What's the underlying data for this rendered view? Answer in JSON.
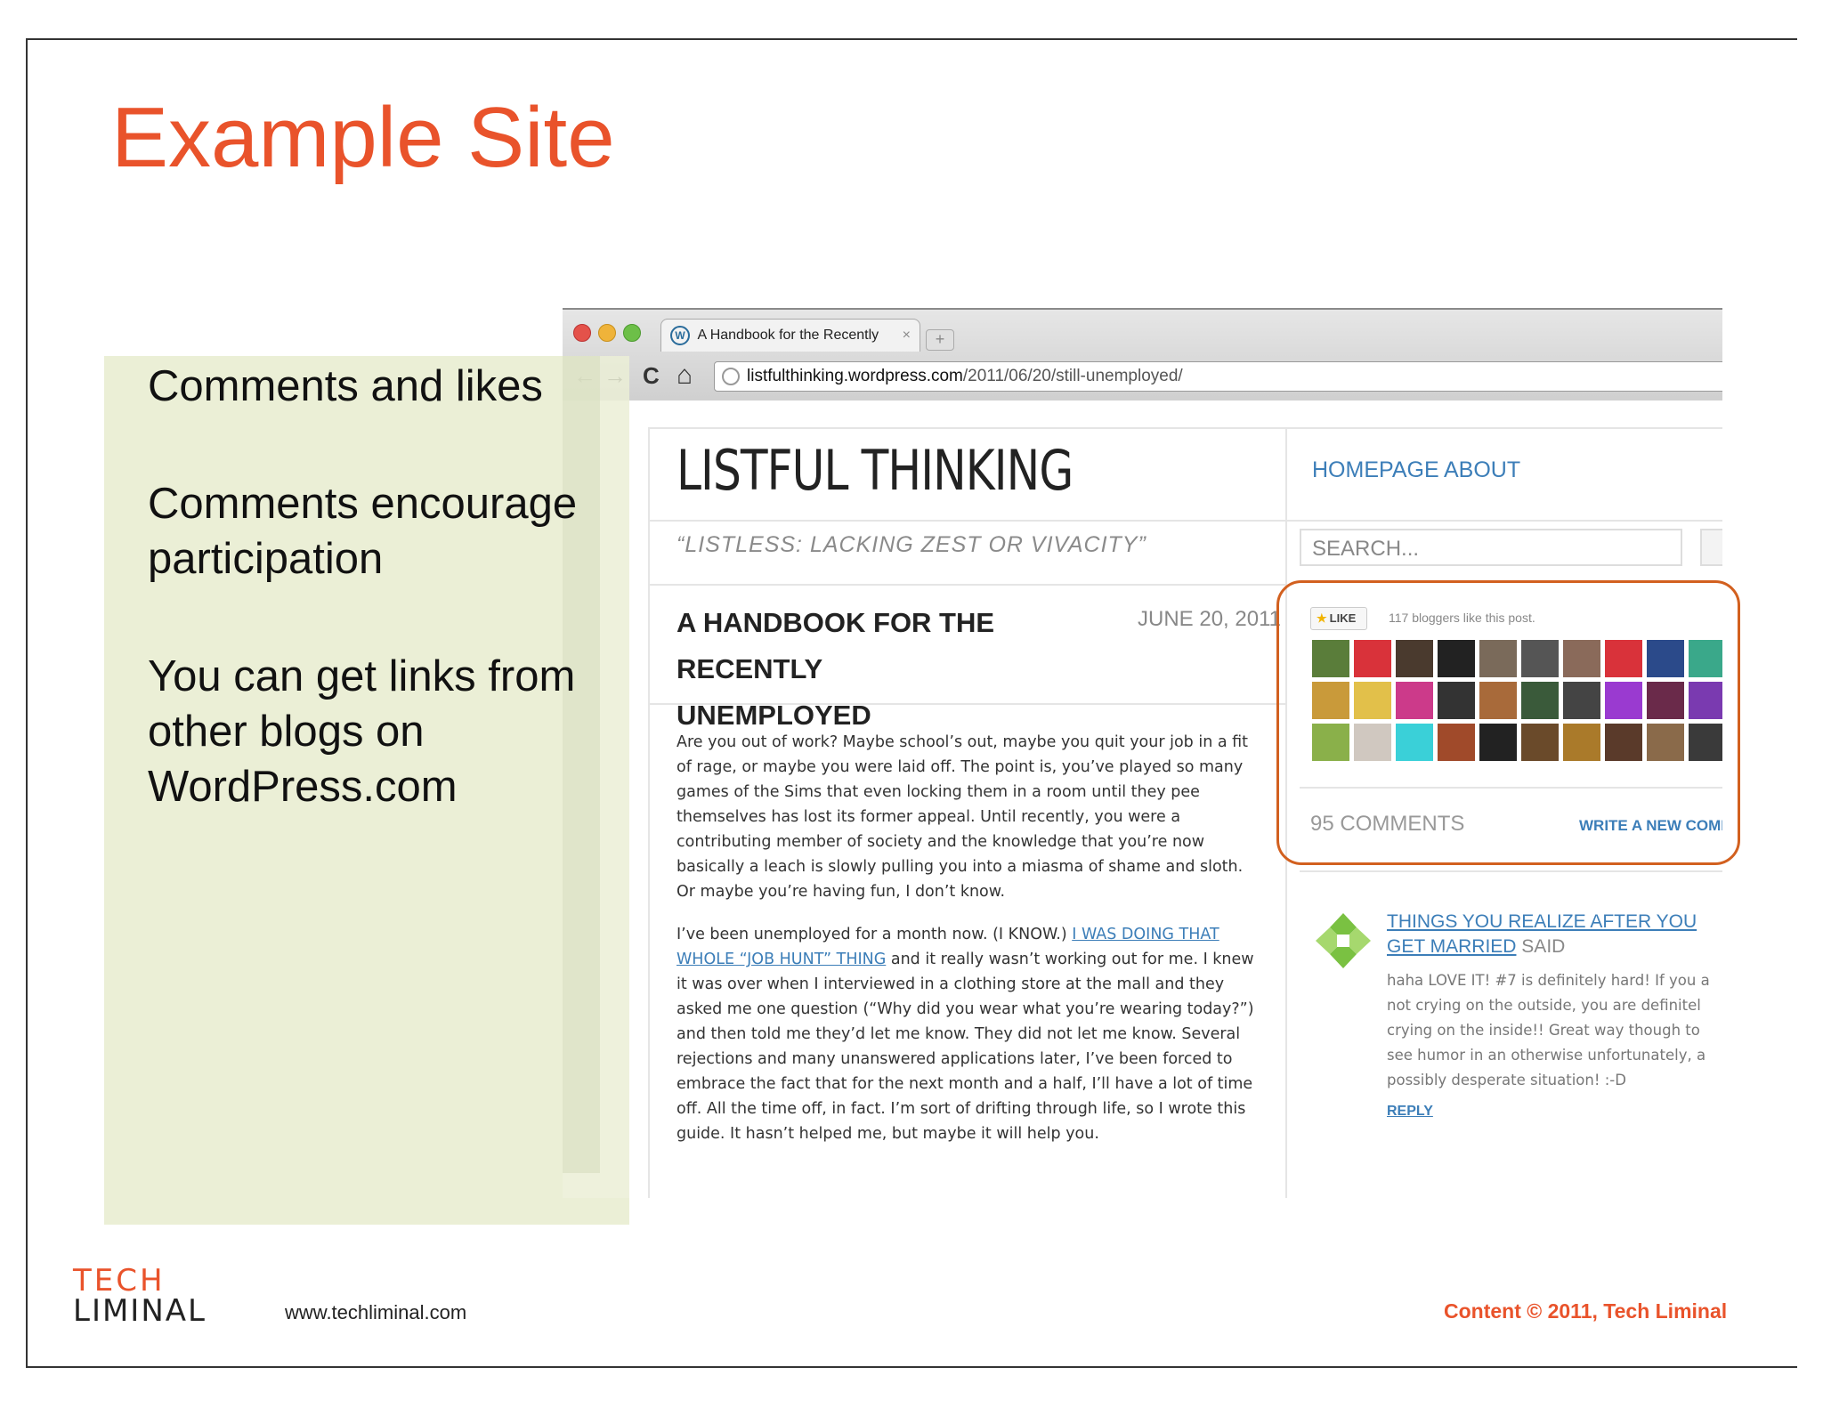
{
  "slide": {
    "title": "Example Site",
    "bullets": [
      "Comments and likes",
      "Comments encourage participation",
      "You can get links from other blogs on WordPress.com"
    ]
  },
  "browser": {
    "tab_title": "A Handbook for the Recently",
    "tab_close": "×",
    "new_tab": "+",
    "back": "←",
    "forward": "→",
    "reload": "C",
    "home": "⌂",
    "url_domain": "listfulthinking.wordpress.com",
    "url_path": "/2011/06/20/still-unemployed/"
  },
  "site": {
    "title": "LISTFUL THINKING",
    "nav": [
      "HOMEPAGE",
      "ABOUT"
    ],
    "tagline": "“LISTLESS: LACKING ZEST OR VIVACITY”",
    "search_placeholder": "SEARCH..."
  },
  "post": {
    "title": "A HANDBOOK FOR THE RECENTLY UNEMPLOYED",
    "date": "JUNE 20, 2011",
    "para1": "Are you out of work? Maybe school’s out, maybe you quit your job in a fit of rage, or maybe you were laid off. The point is, you’ve played so many games of the Sims that even locking them in a room until they pee themselves has lost its former appeal. Until recently, you were a contributing member of society and the knowledge that you’re now basically a leach is slowly pulling you into a miasma of shame and sloth. Or maybe you’re having fun, I don’t know.",
    "para2_pre": "I’ve been unemployed for a month now. (I KNOW.) ",
    "para2_link": "I WAS DOING THAT WHOLE “JOB HUNT” THING",
    "para2_post": " and it really wasn’t working out for me. I knew it was over when I interviewed in a clothing store at the mall and they asked me one question (“Why did you wear what you’re wearing today?”) and then told me they’d let me know. They did not let me know. Several rejections and many unanswered applications later, I’ve been forced to embrace the fact that for the next month and a half, I’ll have a lot of time off. All the time off, in fact. I’m sort of drifting through life, so I wrote this guide. It hasn’t helped me, but maybe it will help you."
  },
  "likes": {
    "button_label": "LIKE",
    "count_text": "117 bloggers like this post.",
    "avatar_colors": [
      "#5a7d3a",
      "#d9323a",
      "#4a3a2e",
      "#222222",
      "#7a6a5a",
      "#555555",
      "#8a6a5a",
      "#d9323a",
      "#2b4a8a",
      "#3aa88a",
      "#c99a3a",
      "#e2c04a",
      "#cc3a8a",
      "#333333",
      "#a86a3a",
      "#3a5a3a",
      "#444444",
      "#9a3ad0",
      "#6a2a4a",
      "#7a3ab0",
      "#8ab04a",
      "#d0c8c0",
      "#3ad0d8",
      "#a04a2a",
      "#222222",
      "#6a4a2a",
      "#aa7a2a",
      "#5a3a2a",
      "#8a6a4a",
      "#3a3a3a"
    ]
  },
  "comments": {
    "count": "95 COMMENTS",
    "write": "WRITE A NEW COMM",
    "first": {
      "post_link": "THINGS YOU REALIZE AFTER YOU GET MARRIED",
      "said": " SAID",
      "lines": [
        "haha LOVE IT! #7 is definitely hard! If you a",
        "not crying on the outside, you are definitel",
        "crying on the inside!! Great way though to",
        "see humor in an otherwise unfortunately, a",
        "possibly desperate situation! :-D"
      ],
      "reply": "REPLY"
    }
  },
  "footer": {
    "logo_top": "TECH",
    "logo_bottom": "LIMINAL",
    "url": "www.techliminal.com",
    "copyright": "Content © 2011, Tech Liminal"
  },
  "colors": {
    "accent": "#e9532b",
    "link": "#3c7eb8",
    "panel": "#ebefd6",
    "highlight": "#d2601f"
  }
}
